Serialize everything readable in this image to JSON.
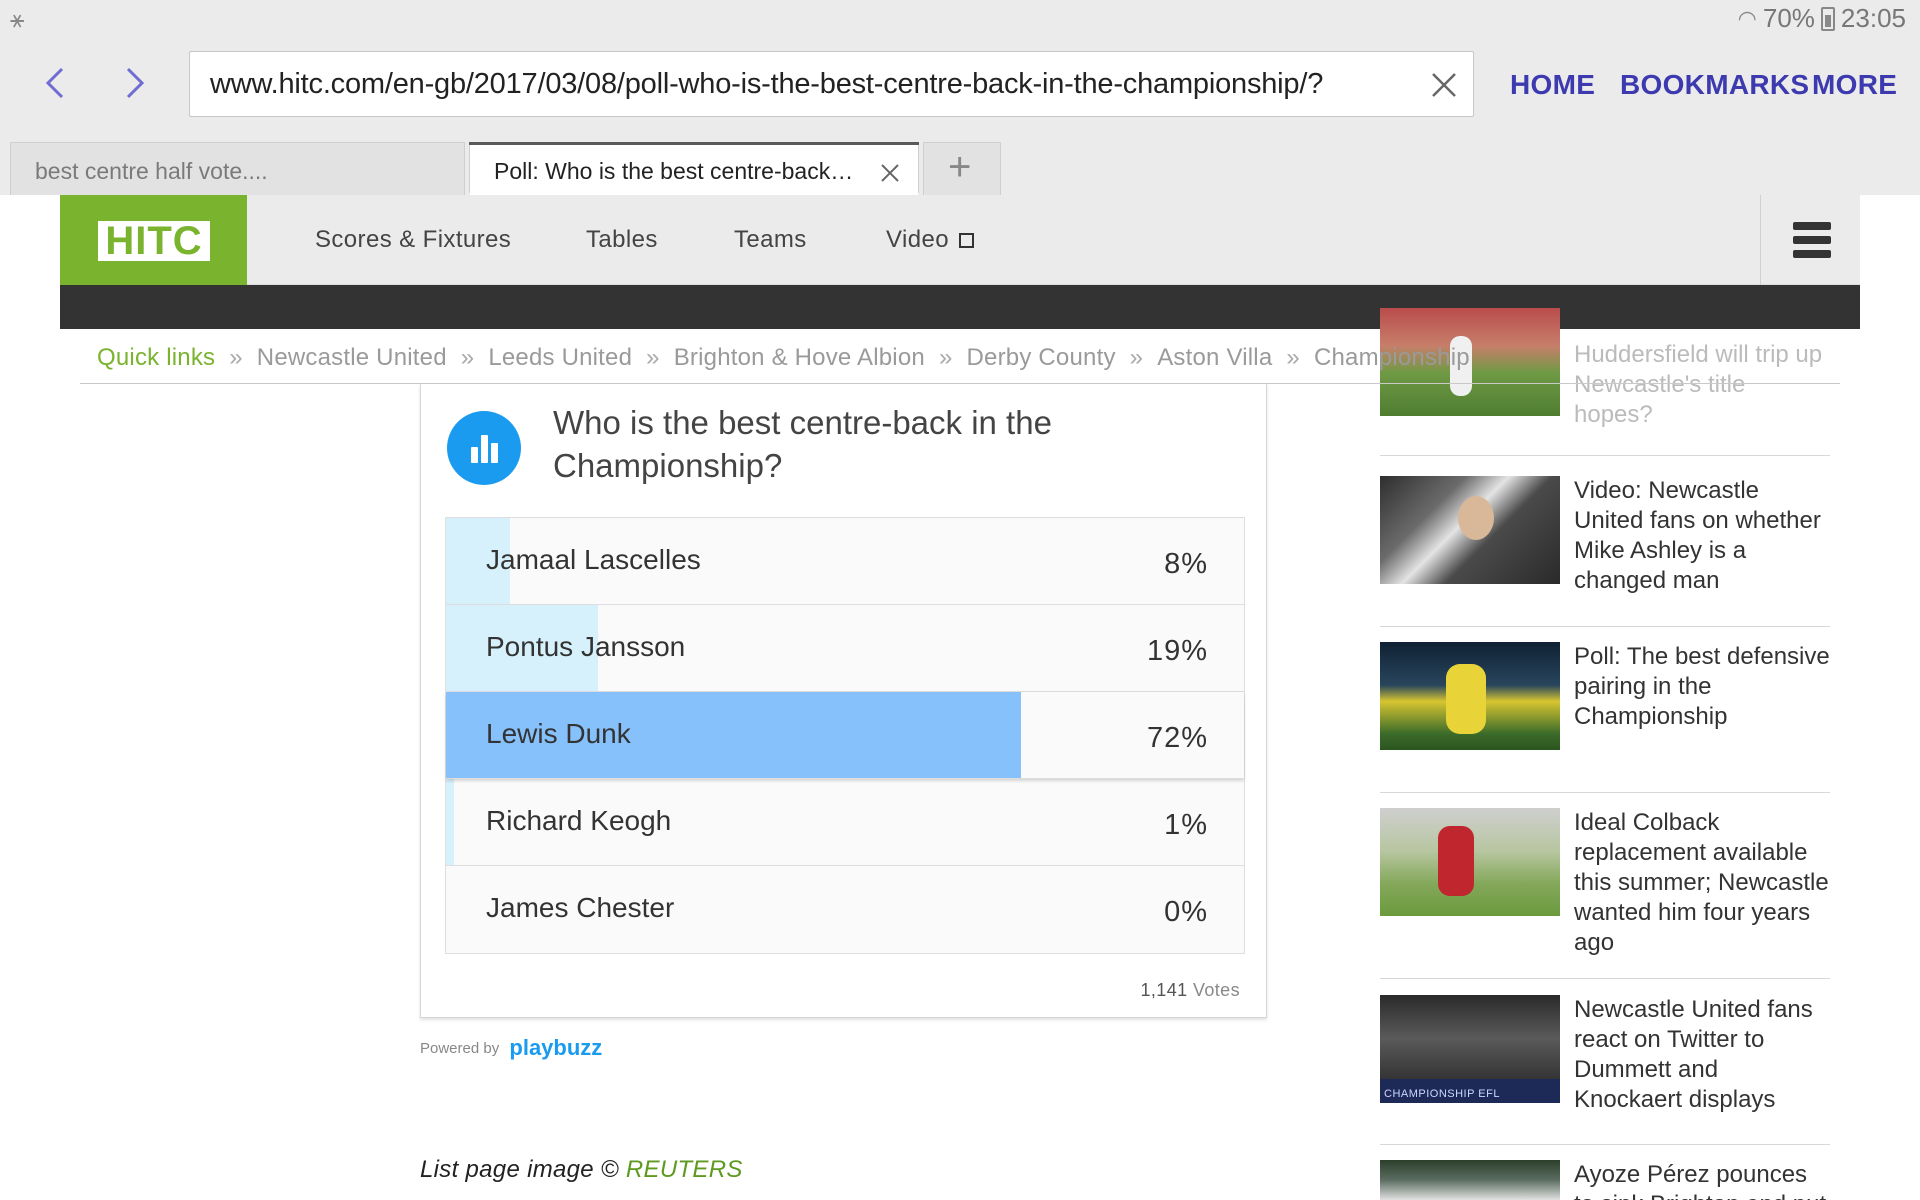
{
  "status_bar": {
    "battery": "70%",
    "time": "23:05"
  },
  "browser": {
    "url": "www.hitc.com/en-gb/2017/03/08/poll-who-is-the-best-centre-back-in-the-championship/?",
    "nav_links": {
      "home": "HOME",
      "bookmarks": "BOOKMARKS",
      "more": "MORE"
    },
    "tabs": [
      {
        "label": "best centre half vote....",
        "active": false
      },
      {
        "label": "Poll: Who is the best centre-back…",
        "active": true
      }
    ],
    "accent_color": "#3d3ab0"
  },
  "site": {
    "logo": "HITC",
    "brand_color": "#7ab32e",
    "nav": [
      "Scores & Fixtures",
      "Tables",
      "Teams",
      "Video"
    ],
    "quick_links": {
      "title": "Quick links",
      "items": [
        "Newcastle United",
        "Leeds United",
        "Brighton & Hove Albion",
        "Derby County",
        "Aston Villa",
        "Championship"
      ]
    }
  },
  "poll": {
    "question": "Who is the best centre-back in the Championship?",
    "options": [
      {
        "name": "Jamaal Lascelles",
        "percent": 8,
        "label": "8%"
      },
      {
        "name": "Pontus Jansson",
        "percent": 19,
        "label": "19%"
      },
      {
        "name": "Lewis Dunk",
        "percent": 72,
        "label": "72%",
        "leader": true
      },
      {
        "name": "Richard Keogh",
        "percent": 1,
        "label": "1%"
      },
      {
        "name": "James Chester",
        "percent": 0,
        "label": "0%"
      }
    ],
    "votes_count": "1,141",
    "votes_word": "Votes",
    "powered_by": "Powered by",
    "brand_part1": "play",
    "brand_part2": "buzz"
  },
  "credit": {
    "text": "List page image ©",
    "source": "REUTERS"
  },
  "sidebar": [
    {
      "title": "Huddersfield will trip up Newcastle's title hopes?"
    },
    {
      "title": "Video: Newcastle United fans on whether Mike Ashley is a changed man"
    },
    {
      "title": "Poll: The best defensive pairing in the Championship"
    },
    {
      "title": "Ideal Colback replacement available this summer; Newcastle wanted him four years ago"
    },
    {
      "title": "Newcastle United fans react on Twitter to Dummett and Knockaert displays",
      "thumb_caption": "CHAMPIONSHIP  EFL"
    },
    {
      "title": "Ayoze Pérez pounces to sink Brighton and put"
    }
  ]
}
